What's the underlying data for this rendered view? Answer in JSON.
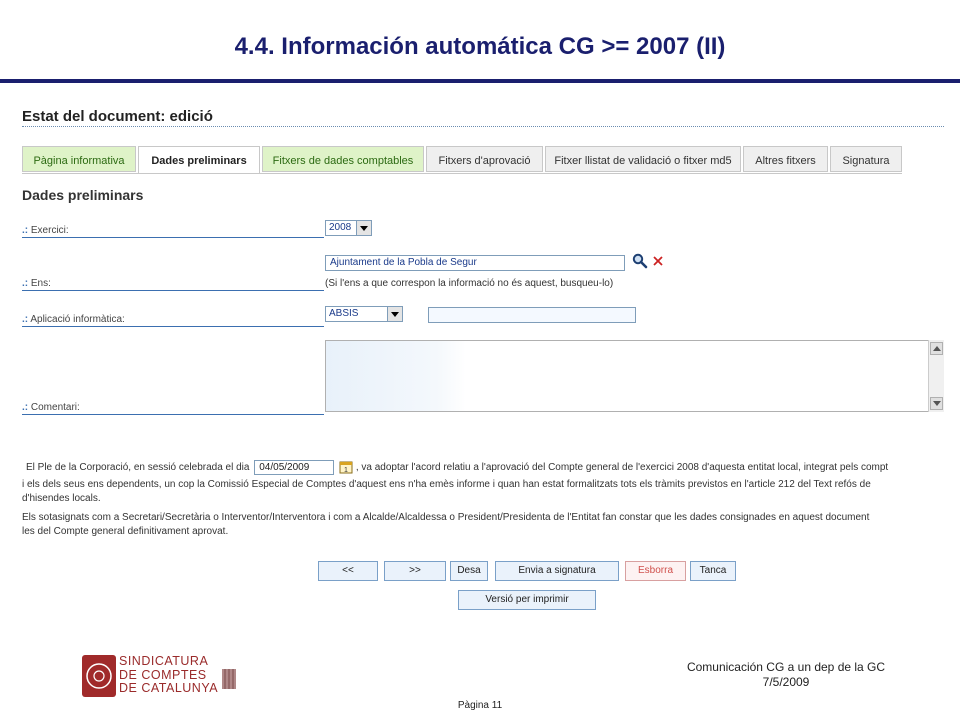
{
  "slide": {
    "title": "4.4. Información automática CG >= 2007 (II)"
  },
  "document": {
    "status": "Estat del document: edició"
  },
  "tabs": [
    {
      "label": "Pàgina informativa",
      "style": "green"
    },
    {
      "label": "Dades preliminars",
      "style": "active"
    },
    {
      "label": "Fitxers de dades comptables",
      "style": "green"
    },
    {
      "label": "Fitxers d'aprovació",
      "style": "normal"
    },
    {
      "label": "Fitxer llistat de validació o fitxer md5",
      "style": "normal"
    },
    {
      "label": "Altres fitxers",
      "style": "normal"
    },
    {
      "label": "Signatura",
      "style": "normal"
    }
  ],
  "section": {
    "title": "Dades preliminars"
  },
  "form": {
    "exercici": {
      "label": "Exercici:",
      "value": "2008"
    },
    "ens": {
      "label": "Ens:",
      "value": "Ajuntament de la Pobla de Segur",
      "hint": "(Si l'ens a que correspon la informació no és aquest, busqueu-lo)"
    },
    "aplicacio": {
      "label": "Aplicació informàtica:",
      "value": "ABSIS",
      "extra_value": ""
    },
    "comentari": {
      "label": "Comentari:",
      "value": ""
    },
    "prefix": ".:"
  },
  "declaration": {
    "text_before_date": "El Ple de la Corporació, en sessió celebrada el dia",
    "date": "04/05/2009",
    "text_after_date_line1": ", va adoptar l'acord relatiu a l'aprovació del Compte general de l'exercici 2008 d'aquesta entitat local, integrat pels compt",
    "line2": "i els dels seus ens dependents, un cop la Comissió Especial de Comptes d'aquest ens n'ha emès informe i quan han estat formalitzats tots els tràmits previstos en l'article 212 del Text refós de",
    "line3": "d'hisendes locals.",
    "signatories_line1": "Els sotasignats com a Secretari/Secretària o Interventor/Interventora i com a Alcalde/Alcaldessa o President/Presidenta de l'Entitat fan constar que les dades consignades en aquest document",
    "signatories_line2": "les del Compte general definitivament aprovat."
  },
  "buttons": {
    "prev": "<<",
    "next": ">>",
    "save": "Desa",
    "send_signature": "Envia a signatura",
    "delete": "Esborra",
    "close": "Tanca",
    "print_version": "Versió per imprimir"
  },
  "icons": {
    "search": "magnifier-icon",
    "clear": "red-x-icon",
    "calendar": "calendar-icon"
  },
  "colors": {
    "title": "#1a1f6e",
    "accent_blue": "#3b6fb0",
    "tab_green": "#dff3c8",
    "danger": "#d0504c"
  },
  "footer": {
    "logo_text": [
      "SINDICATURA",
      "DE COMPTES",
      "DE CATALUNYA"
    ],
    "caption_line1": "Comunicación CG a un dep de la GC",
    "caption_line2": "7/5/2009",
    "page_label": "Pàgina 11"
  }
}
